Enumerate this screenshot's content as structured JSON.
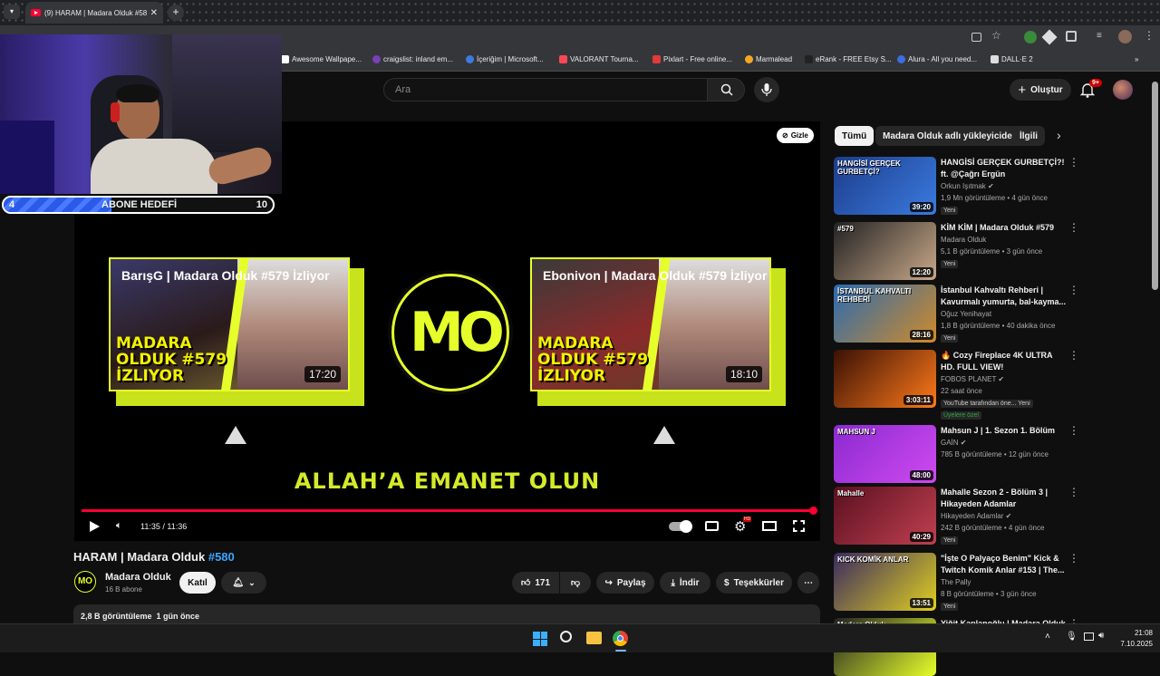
{
  "browser": {
    "tab_title": "(9) HARAM | Madara Olduk #58",
    "bookmarks": [
      {
        "label": "Awesome Wallpape...",
        "color": "#ffffff"
      },
      {
        "label": "craigslist: inland em...",
        "color": "#7b3fb8"
      },
      {
        "label": "İçeriğim | Microsoft...",
        "color": "#3d7be0"
      },
      {
        "label": "VALORANT Tourna...",
        "color": "#ff4655"
      },
      {
        "label": "Pixlart - Free online...",
        "color": "#e03a3a"
      },
      {
        "label": "Marmalead",
        "color": "#f5a623"
      },
      {
        "label": "eRank - FREE Etsy S...",
        "color": "#222222"
      },
      {
        "label": "Alura - All you need...",
        "color": "#3d6de0"
      },
      {
        "label": "DALL·E 2",
        "color": "#dddddd"
      }
    ]
  },
  "header": {
    "search_placeholder": "Ara",
    "create_label": "Oluştur",
    "notifications_badge": "9+"
  },
  "overlay": {
    "goal_current": "4",
    "goal_label": "ABONE HEDEFİ",
    "goal_target": "10",
    "goal_progress": 0.4
  },
  "player": {
    "hide_label": "Gizle",
    "card_left": {
      "title": "BarışG | Madara Olduk #579 İzliyor",
      "big_text": "MADARA OLDUK #579 İZLIYOR",
      "duration": "17:20"
    },
    "card_right": {
      "title": "Ebonivon | Madara Olduk #579 İzliyor",
      "big_text": "MADARA OLDUK #579 İZLIYOR",
      "duration": "18:10"
    },
    "logo_text": "MO",
    "outro_text": "ALLAH’A EMANET OLUN",
    "time": "11:35 / 11:36",
    "progress": 1.0,
    "settings_badge": "HD"
  },
  "video": {
    "title": "HARAM | Madara Olduk",
    "hashtag": "#580",
    "channel": "Madara Olduk",
    "subscribers": "16 B abone",
    "join_label": "Katıl",
    "likes": "171",
    "share_label": "Paylaş",
    "download_label": "İndir",
    "thanks_label": "Teşekkürler",
    "views_date": "2,8 B görüntüleme  1 gün önce"
  },
  "chips": [
    "Tümü",
    "Madara Olduk adlı yükleyiciden",
    "İlgili"
  ],
  "recommendations": [
    {
      "title": "HANGİSİ GERÇEK GURBETÇİ?! ft. @Çağrı Ergün",
      "channel": "Orkun Işıtmak ✔",
      "meta": "1,9 Mn görüntüleme • 4 gün önce",
      "badge": "Yeni",
      "duration": "39:20",
      "thumb_text": "HANGİSİ GERÇEK GURBETÇİ?",
      "colors": [
        "#1d3c8a",
        "#3a7be0"
      ]
    },
    {
      "title": "KİM KİM | Madara Olduk #579",
      "channel": "Madara Olduk",
      "meta": "5,1 B görüntüleme • 3 gün önce",
      "badge": "Yeni",
      "duration": "12:20",
      "thumb_text": "#579",
      "colors": [
        "#222222",
        "#c9a98a"
      ]
    },
    {
      "title": "İstanbul Kahvaltı Rehberi | Kavurmalı yumurta, bal-kayma...",
      "channel": "Oğuz Yenihayat",
      "meta": "1,8 B görüntüleme • 40 dakika önce",
      "badge": "Yeni",
      "duration": "28:16",
      "thumb_text": "İSTANBUL KAHVALTI REHBERİ",
      "colors": [
        "#2a6bb0",
        "#d08a2a"
      ]
    },
    {
      "title": "🔥 Cozy Fireplace 4K ULTRA HD. FULL VIEW!",
      "channel": "FOBOS PLANET ✔",
      "meta": "22 saat önce",
      "badge": "YouTube tarafından öne...   Yeni",
      "badge2": "Üyelere özel",
      "duration": "3:03:11",
      "thumb_text": "",
      "colors": [
        "#3a1005",
        "#ff7a1a"
      ]
    },
    {
      "title": "Mahsun J | 1. Sezon 1. Bölüm",
      "channel": "GAİN ✔",
      "meta": "785 B görüntüleme • 12 gün önce",
      "badge": "",
      "duration": "48:00",
      "thumb_text": "MAHSUN J",
      "colors": [
        "#8a2ad0",
        "#d04af0"
      ]
    },
    {
      "title": "Mahalle Sezon 2 - Bölüm 3 | Hikayeden Adamlar",
      "channel": "Hikayeden Adamlar ✔",
      "meta": "242 B görüntüleme • 4 gün önce",
      "badge": "Yeni",
      "duration": "40:29",
      "thumb_text": "Mahalle",
      "colors": [
        "#5a1020",
        "#c04050"
      ]
    },
    {
      "title": "\"İşte O Palyaço Benim\" Kick & Twitch Komik Anlar #153 | The...",
      "channel": "The Pally",
      "meta": "8 B görüntüleme • 3 gün önce",
      "badge": "Yeni",
      "duration": "13:51",
      "thumb_text": "KICK KOMİK ANLAR",
      "colors": [
        "#3a2a60",
        "#e0d020"
      ]
    },
    {
      "title": "Yiğit Kaplanoğlu | Madara Olduk",
      "channel": "",
      "meta": "",
      "badge": "",
      "duration": "",
      "thumb_text": "Madara Olduk",
      "colors": [
        "#222222",
        "#e6ff2a"
      ]
    }
  ],
  "taskbar": {
    "time": "21:08",
    "date": "7.10.2025"
  }
}
